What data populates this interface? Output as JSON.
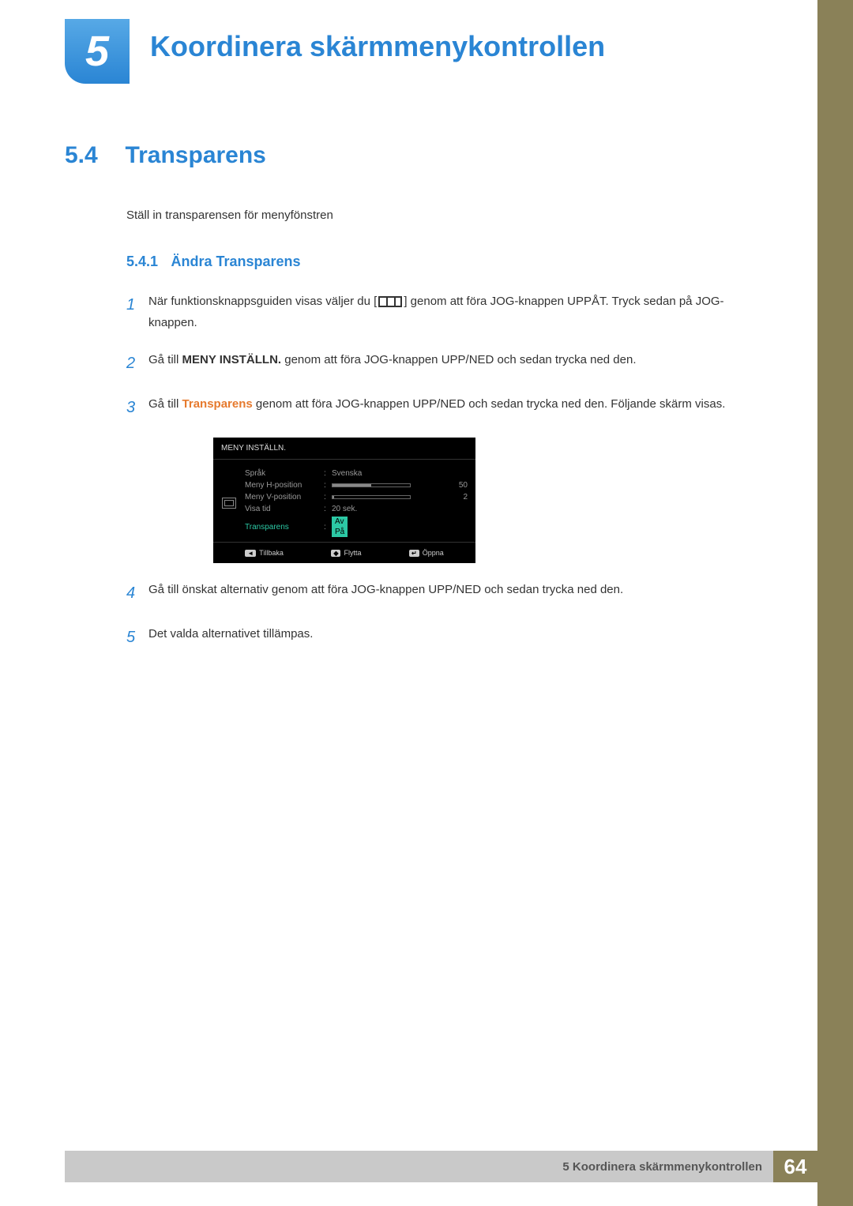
{
  "chapter": {
    "number": "5",
    "title": "Koordinera skärmmenykontrollen"
  },
  "section": {
    "number": "5.4",
    "title": "Transparens",
    "intro": "Ställ in transparensen för menyfönstren"
  },
  "subsection": {
    "number": "5.4.1",
    "title": "Ändra Transparens"
  },
  "steps": {
    "s1a": "När funktionsknappsguiden visas väljer du [",
    "s1b": "] genom att föra JOG-knappen UPPÅT. Tryck sedan på JOG-knappen.",
    "s2a": "Gå till ",
    "s2bold": "MENY INSTÄLLN.",
    "s2b": " genom att föra JOG-knappen UPP/NED och sedan trycka ned den.",
    "s3a": "Gå till ",
    "s3orange": "Transparens",
    "s3b": " genom att föra JOG-knappen UPP/NED och sedan trycka ned den. Följande skärm visas.",
    "s4": "Gå till önskat alternativ genom att föra JOG-knappen UPP/NED och sedan trycka ned den.",
    "s5": "Det valda alternativet tillämpas."
  },
  "osd": {
    "header": "MENY INSTÄLLN.",
    "rows": {
      "language": {
        "label": "Språk",
        "value": "Svenska"
      },
      "hpos": {
        "label": "Meny H-position",
        "value": "50",
        "fill": "50%"
      },
      "vpos": {
        "label": "Meny V-position",
        "value": "2",
        "fill": "2%"
      },
      "showtime": {
        "label": "Visa tid",
        "value": "20 sek."
      },
      "transparency": {
        "label": "Transparens",
        "off": "Av",
        "on": "På"
      }
    },
    "footer": {
      "back": "Tillbaka",
      "move": "Flytta",
      "open": "Öppna"
    }
  },
  "footer": {
    "text": "5 Koordinera skärmmenykontrollen",
    "page": "64"
  }
}
